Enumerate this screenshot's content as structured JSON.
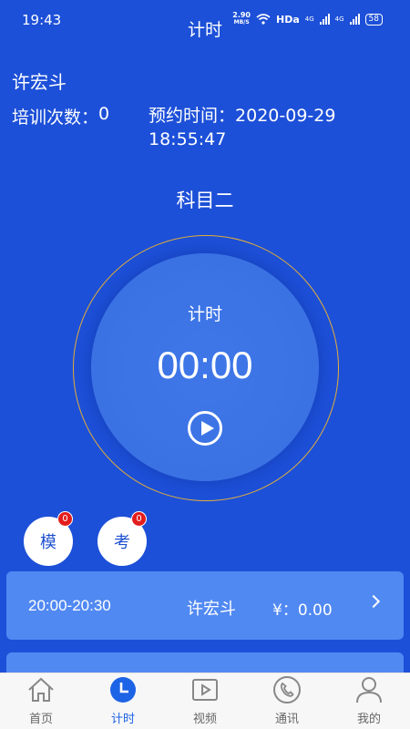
{
  "status": {
    "time": "19:43",
    "speed": "2.90",
    "speed_unit": "MB/S",
    "hd": "HDa",
    "net1": "4G",
    "net2": "4G",
    "battery": "58"
  },
  "header": {
    "title": "计时"
  },
  "trainee": {
    "name": "许宏斗",
    "train_count_label": "培训次数：",
    "train_count": "0",
    "appoint_label": "预约时间：",
    "appoint_date": "2020-09-29",
    "appoint_time": "18:55:47"
  },
  "subject": "科目二",
  "timer": {
    "label": "计时",
    "value": "00:00"
  },
  "quick": [
    {
      "label": "模",
      "badge": "0"
    },
    {
      "label": "考",
      "badge": "0"
    }
  ],
  "schedule": [
    {
      "slot": "20:00-20:30",
      "person": "许宏斗",
      "price": "¥：0.00"
    }
  ],
  "tabs": [
    {
      "label": "首页",
      "icon": "home-icon"
    },
    {
      "label": "计时",
      "icon": "clock-icon",
      "active": true
    },
    {
      "label": "视频",
      "icon": "video-icon"
    },
    {
      "label": "通讯",
      "icon": "phone-icon"
    },
    {
      "label": "我的",
      "icon": "profile-icon"
    }
  ],
  "colors": {
    "background": "#1d50d8",
    "accent": "#1d63e6",
    "ring": "#e2ad3b",
    "card": "#5189f2",
    "badge": "#e31d1d"
  }
}
